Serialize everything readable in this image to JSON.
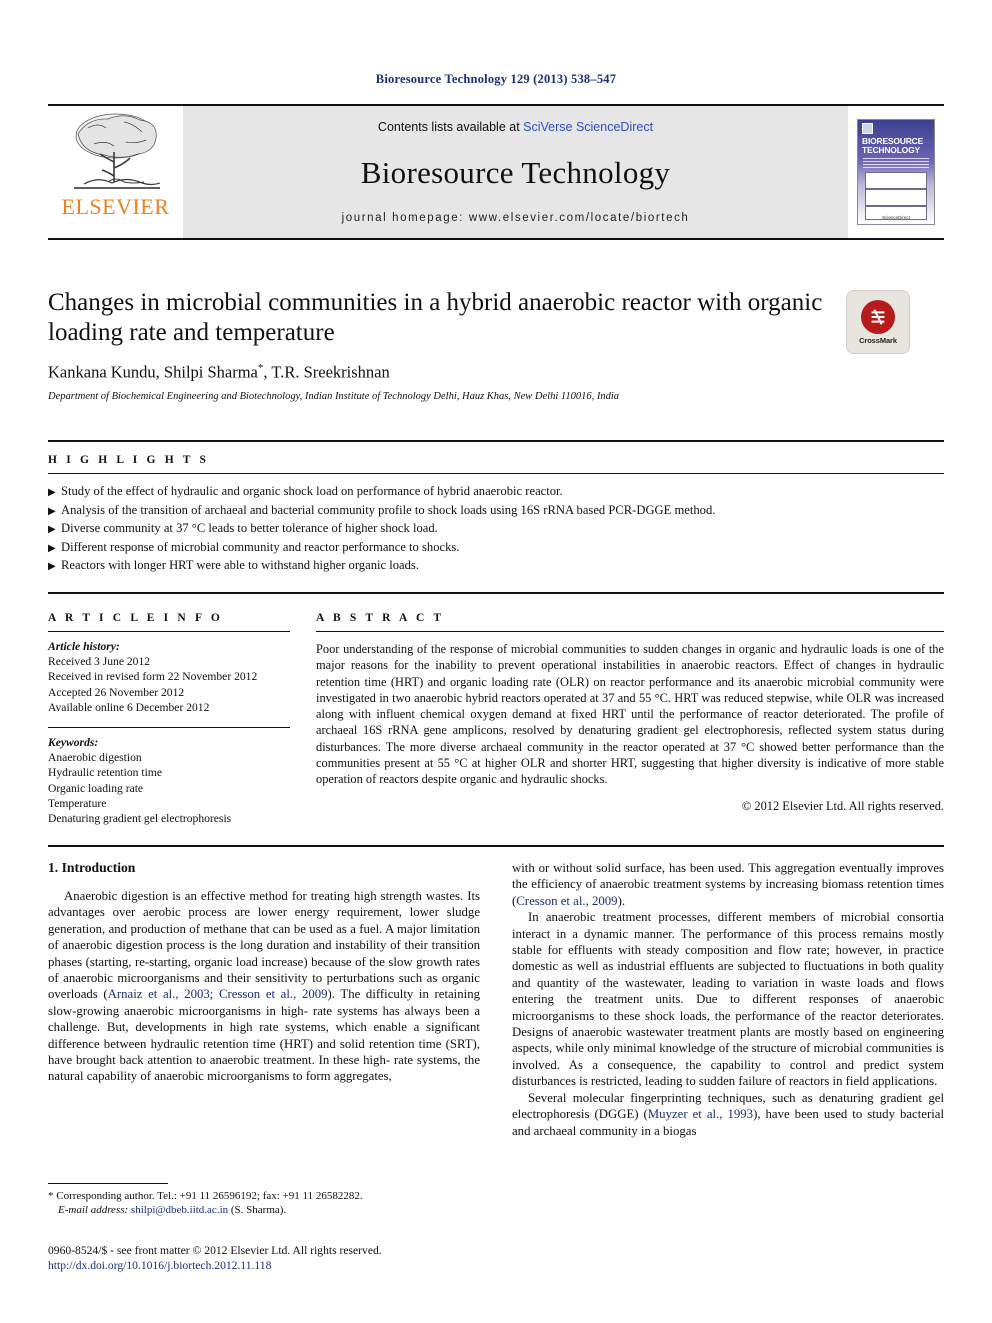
{
  "running_head": "Bioresource Technology 129 (2013) 538–547",
  "masthead": {
    "contents_prefix": "Contents lists available at ",
    "contents_link": "SciVerse ScienceDirect",
    "journal_name": "Bioresource Technology",
    "homepage": "journal homepage: www.elsevier.com/locate/biortech",
    "publisher_name": "ELSEVIER",
    "publisher_logo": "elsevier-tree-logo",
    "cover_title_line1": "BIORESOURCE",
    "cover_title_line2": "TECHNOLOGY",
    "cover_footer": "ScienceDirect"
  },
  "crossmark": {
    "label": "CrossMark",
    "icon": "crossmark-icon"
  },
  "article": {
    "title": "Changes in microbial communities in a hybrid anaerobic reactor with organic loading rate and temperature",
    "authors": "Kankana Kundu, Shilpi Sharma",
    "authors_star": "*",
    "authors_tail": ", T.R. Sreekrishnan",
    "affiliation": "Department of Biochemical Engineering and Biotechnology, Indian Institute of Technology Delhi, Hauz Khas, New Delhi 110016, India"
  },
  "highlights": {
    "heading": "H I G H L I G H T S",
    "bullet_glyph": "▶",
    "items": [
      "Study of the effect of hydraulic and organic shock load on performance of hybrid anaerobic reactor.",
      "Analysis of the transition of archaeal and bacterial community profile to shock loads using 16S rRNA based PCR-DGGE method.",
      "Diverse community at 37 °C leads to better tolerance of higher shock load.",
      "Different response of microbial community and reactor performance to shocks.",
      "Reactors with longer HRT were able to withstand higher organic loads."
    ]
  },
  "article_info": {
    "heading": "A R T I C L E    I N F O",
    "history_label": "Article history:",
    "history": [
      "Received 3 June 2012",
      "Received in revised form 22 November 2012",
      "Accepted 26 November 2012",
      "Available online 6 December 2012"
    ],
    "keywords_label": "Keywords:",
    "keywords": [
      "Anaerobic digestion",
      "Hydraulic retention time",
      "Organic loading rate",
      "Temperature",
      "Denaturing gradient gel electrophoresis"
    ]
  },
  "abstract": {
    "heading": "A B S T R A C T",
    "text": "Poor understanding of the response of microbial communities to sudden changes in organic and hydraulic loads is one of the major reasons for the inability to prevent operational instabilities in anaerobic reactors. Effect of changes in hydraulic retention time (HRT) and organic loading rate (OLR) on reactor performance and its anaerobic microbial community were investigated in two anaerobic hybrid reactors operated at 37 and 55 °C. HRT was reduced stepwise, while OLR was increased along with influent chemical oxygen demand at fixed HRT until the performance of reactor deteriorated. The profile of archaeal 16S rRNA gene amplicons, resolved by denaturing gradient gel electrophoresis, reflected system status during disturbances. The more diverse archaeal community in the reactor operated at 37 °C showed better performance than the communities present at 55 °C at higher OLR and shorter HRT, suggesting that higher diversity is indicative of more stable operation of reactors despite organic and hydraulic shocks.",
    "copyright": "© 2012 Elsevier Ltd. All rights reserved."
  },
  "introduction": {
    "heading": "1. Introduction",
    "left_paragraph_1_a": "Anaerobic digestion is an effective method for treating high strength wastes. Its advantages over aerobic process are lower energy requirement, lower sludge generation, and production of methane that can be used as a fuel. A major limitation of anaerobic digestion process is the long duration and instability of their transition phases (starting, re-starting, organic load increase) because of the slow growth rates of anaerobic microorganisms and their sensitivity to perturbations such as organic overloads (",
    "left_cite_1": "Arnaiz et al., 2003; Cresson et al., 2009",
    "left_paragraph_1_b": "). The difficulty in retaining slow-growing anaerobic microorganisms in high- rate systems has always been a challenge. But, developments in high rate systems, which enable a significant difference between hydraulic retention time (HRT) and solid retention time (SRT), have brought back attention to anaerobic treatment. In these high- rate systems, the natural capability of anaerobic microorganisms to form aggregates,",
    "right_paragraph_1_a": "with or without solid surface, has been used. This aggregation eventually improves the efficiency of anaerobic treatment systems by increasing biomass retention times (",
    "right_cite_1": "Cresson et al., 2009",
    "right_paragraph_1_b": ").",
    "right_paragraph_2": "In anaerobic treatment processes, different members of microbial consortia interact in a dynamic manner. The performance of this process remains mostly stable for effluents with steady composition and flow rate; however, in practice domestic as well as industrial effluents are subjected to fluctuations in both quality and quantity of the wastewater, leading to variation in waste loads and flows entering the treatment units. Due to different responses of anaerobic microorganisms to these shock loads, the performance of the reactor deteriorates. Designs of anaerobic wastewater treatment plants are mostly based on engineering aspects, while only minimal knowledge of the structure of microbial communities is involved. As a consequence, the capability to control and predict system disturbances is restricted, leading to sudden failure of reactors in field applications.",
    "right_paragraph_3_a": "Several molecular fingerprinting techniques, such as denaturing gradient gel electrophoresis (DGGE) (",
    "right_cite_2": "Muyzer et al., 1993",
    "right_paragraph_3_b": "), have been used to study bacterial and archaeal community in a biogas"
  },
  "footnote": {
    "star": "*",
    "corresponding": " Corresponding author. Tel.: +91 11 26596192; fax: +91 11 26582282.",
    "email_label": "E-mail address:",
    "email": "shilpi@dbeb.iitd.ac.in",
    "email_suffix": " (S. Sharma)."
  },
  "footer": {
    "issn_line": "0960-8524/$ - see front matter © 2012 Elsevier Ltd. All rights reserved.",
    "doi": "http://dx.doi.org/10.1016/j.biortech.2012.11.118"
  }
}
